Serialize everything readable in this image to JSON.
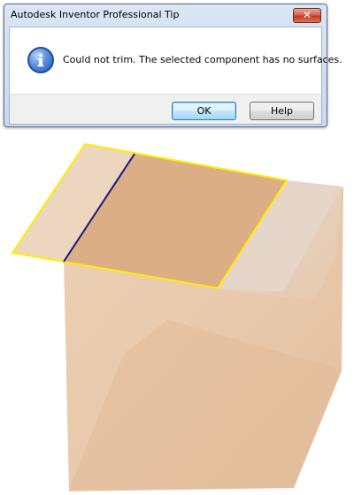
{
  "dialog": {
    "title": "Autodesk Inventor Professional Tip",
    "close_glyph": "✕",
    "icon": "info-icon",
    "message": "Could not trim. The selected component has no surfaces.",
    "ok_label": "OK",
    "help_label": "Help"
  },
  "model": {
    "box_color": "#e8c9aa",
    "top_face_color": "#dcae86",
    "left_strip_color": "#ecd9c6",
    "right_strip_color": "#e4d5cc",
    "edge_highlight_color": "#ffee00",
    "split_line_color": "#1a1a7a"
  }
}
